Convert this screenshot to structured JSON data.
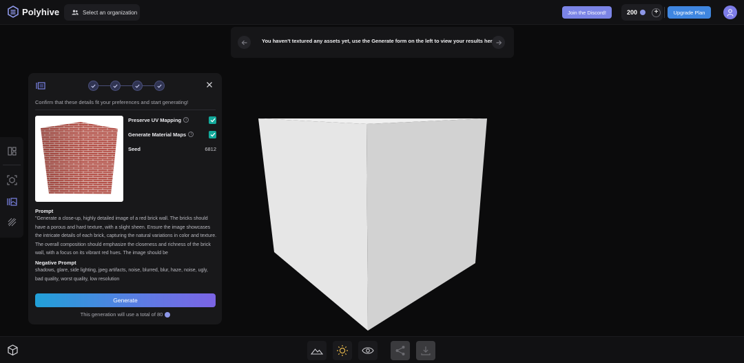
{
  "header": {
    "app_name": "Polyhive",
    "org_selector": "Select an organization",
    "discord_label": "Join the Discord!",
    "credits": "200",
    "upgrade_label": "Upgrade Plan"
  },
  "notice": {
    "text": "You haven't textured any assets yet, use the Generate form on the left to view your results here!"
  },
  "panel": {
    "steps_completed": 4,
    "confirm_text": "Confirm that these details fit your preferences and start generating!",
    "options": [
      {
        "label": "Preserve UV Mapping",
        "checked": true
      },
      {
        "label": "Generate Material Maps",
        "checked": true
      }
    ],
    "seed_label": "Seed",
    "seed_value": "6812",
    "prompt_title": "Prompt",
    "prompt_text": "\"Generate a close-up, highly detailed image of a red brick wall. The bricks should have a porous and hard texture, with a slight sheen. Ensure the image showcases the intricate details of each brick, capturing the natural variations in color and texture. The overall composition should emphasize the closeness and richness of the brick wall, with a focus on its vibrant red hues. The image should be",
    "negative_title": "Negative Prompt",
    "negative_text": "shadows, glare, side lighting, jpeg artifacts, noise, blurred, blur, haze, noise, ugly, bad quality, worst quality, low resolution",
    "generate_label": "Generate",
    "cost_text": "This generation will use a total of 80"
  },
  "colors": {
    "accent": "#7b84e6",
    "upgrade": "#3f86e0",
    "check": "#13a99b",
    "brick": "#b5524a"
  }
}
